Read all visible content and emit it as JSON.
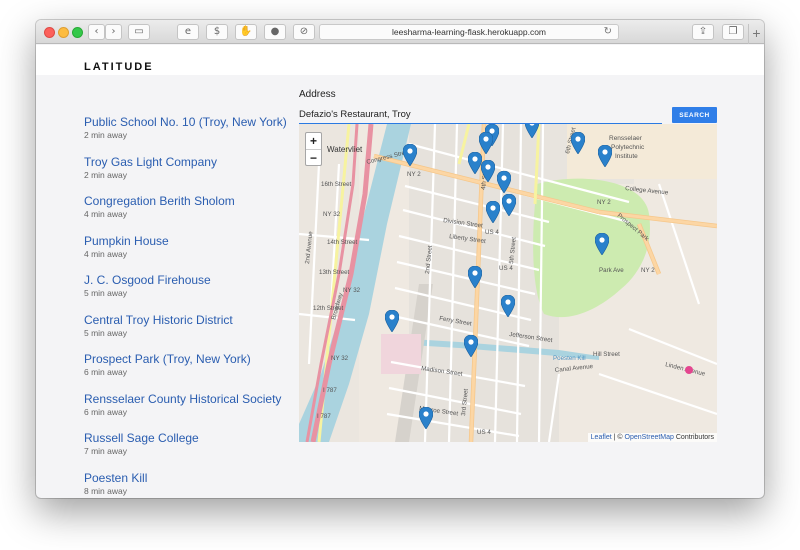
{
  "browser": {
    "url": "leesharma-learning-flask.herokuapp.com",
    "buttons": {
      "dollar_label": "$"
    }
  },
  "site": {
    "logo": "LATITUDE"
  },
  "search": {
    "label": "Address",
    "value": "Defazio's Restaurant, Troy",
    "button": "SEARCH"
  },
  "results": [
    {
      "name": "Public School No. 10 (Troy, New York)",
      "distance": "2 min away"
    },
    {
      "name": "Troy Gas Light Company",
      "distance": "2 min away"
    },
    {
      "name": "Congregation Berith Sholom",
      "distance": "4 min away"
    },
    {
      "name": "Pumpkin House",
      "distance": "4 min away"
    },
    {
      "name": "J. C. Osgood Firehouse",
      "distance": "5 min away"
    },
    {
      "name": "Central Troy Historic District",
      "distance": "5 min away"
    },
    {
      "name": "Prospect Park (Troy, New York)",
      "distance": "6 min away"
    },
    {
      "name": "Rensselaer County Historical Society",
      "distance": "6 min away"
    },
    {
      "name": "Russell Sage College",
      "distance": "7 min away"
    },
    {
      "name": "Poesten Kill",
      "distance": "8 min away"
    }
  ],
  "map": {
    "zoom_in": "+",
    "zoom_out": "−",
    "attribution": {
      "leaflet": "Leaflet",
      "sep": " | © ",
      "osm": "OpenStreetMap",
      "suffix": " Contributors"
    },
    "labels": {
      "watervliet": "Watervliet",
      "rensselaer": "Rensselaer",
      "polytechnic": "Polytechnic",
      "institute": "Institute",
      "congress": "Congress Street",
      "ny2a": "NY 2",
      "ny2b": "NY 2",
      "ny2c": "NY 2",
      "ny32a": "NY 32",
      "ny32b": "NY 32",
      "ny32c": "NY 32",
      "us4a": "US 4",
      "us4b": "US 4",
      "us4c": "US 4",
      "i787a": "I 787",
      "i787b": "I 787",
      "poesten": "Poesten Kill",
      "park": "Park Ave",
      "street5": "5th Street",
      "liberty": "Liberty Street",
      "division": "Division Street",
      "madison": "Madison Street",
      "jefferson": "Jefferson Street",
      "monroe": "Monroe Street",
      "canal": "Canal Avenue",
      "hill": "Hill Street",
      "linden": "Linden Avenue",
      "college": "College Avenue",
      "prospect": "Prospect Park",
      "street2": "2nd Avenue",
      "street16": "16th Street",
      "street14": "14th Street",
      "street13": "13th Street",
      "street12": "12th Street",
      "broadway": "Broadway",
      "street4": "4th Street",
      "street6": "6th Street",
      "street2nd": "2nd Street",
      "ferry": "Ferry Street",
      "street3": "3rd Street"
    }
  },
  "colors": {
    "accent": "#2f7ee8",
    "link": "#2a5db0",
    "river": "#aad3df",
    "park": "#cdebb0",
    "motorway": "#e892a2",
    "primary": "#fcd6a4",
    "marker": "#2a81cb"
  }
}
